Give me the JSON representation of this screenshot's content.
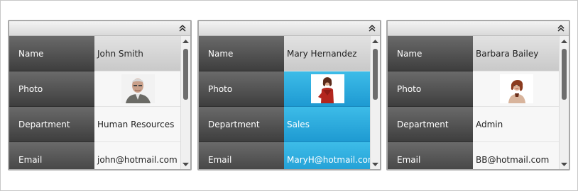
{
  "colors": {
    "label_bg": "#4f4f4f",
    "selected_bg": "#27a9df",
    "header_bg": "#e6e6e6"
  },
  "field_labels": {
    "name": "Name",
    "photo": "Photo",
    "department": "Department",
    "email": "Email"
  },
  "cards": [
    {
      "name": "John Smith",
      "department": "Human Resources",
      "email": "john@hotmail.com",
      "photo_icon": "person-photo-elderly-man",
      "selected": false
    },
    {
      "name": "Mary Hernandez",
      "department": "Sales",
      "email": "MaryH@hotmail.com",
      "photo_icon": "person-photo-woman-red",
      "selected": true
    },
    {
      "name": "Barbara Bailey",
      "department": "Admin",
      "email": "BB@hotmail.com",
      "photo_icon": "person-photo-woman-pose",
      "selected": false
    }
  ]
}
